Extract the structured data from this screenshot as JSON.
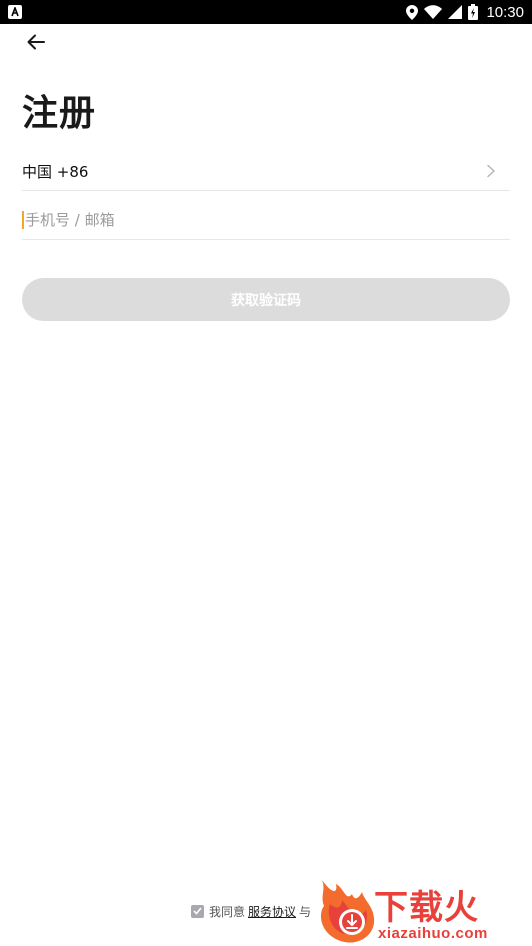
{
  "status_bar": {
    "time": "10:30",
    "icons": [
      "notification-a-icon",
      "location-icon",
      "wifi-icon",
      "signal-icon",
      "battery-icon"
    ]
  },
  "header": {
    "back_icon": "arrow-left-icon",
    "title": "注册"
  },
  "form": {
    "country_label": "中国 +86",
    "country_chevron": "chevron-right-icon",
    "phone_placeholder": "手机号 / 邮箱",
    "phone_value": "",
    "code_button_label": "获取验证码",
    "code_button_enabled": false
  },
  "agreement": {
    "checked": true,
    "prefix": "我同意",
    "service_link": "服务协议",
    "joiner": "与"
  },
  "watermark": {
    "title": "下载火",
    "url": "xiazaihuo.com"
  },
  "colors": {
    "status_bar": "#000000",
    "accent_caret": "#f5a623",
    "disabled_button": "#dcdcdc",
    "watermark": "#e8413b"
  }
}
